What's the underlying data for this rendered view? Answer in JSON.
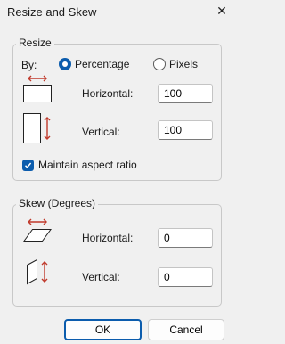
{
  "window": {
    "title": "Resize and Skew",
    "close_icon": "close-icon"
  },
  "resize": {
    "legend": "Resize",
    "by_label": "By:",
    "options": [
      {
        "label": "Percentage",
        "selected": true
      },
      {
        "label": "Pixels",
        "selected": false
      }
    ],
    "horizontal_label": "Horizontal:",
    "horizontal_value": "100",
    "vertical_label": "Vertical:",
    "vertical_value": "100",
    "maintain_aspect_label": "Maintain aspect ratio",
    "maintain_aspect_checked": true
  },
  "skew": {
    "legend": "Skew (Degrees)",
    "horizontal_label": "Horizontal:",
    "horizontal_value": "0",
    "vertical_label": "Vertical:",
    "vertical_value": "0"
  },
  "buttons": {
    "ok": "OK",
    "cancel": "Cancel"
  },
  "colors": {
    "accent": "#0b5cad",
    "arrow": "#c0392b",
    "background": "#f0f0f0"
  }
}
